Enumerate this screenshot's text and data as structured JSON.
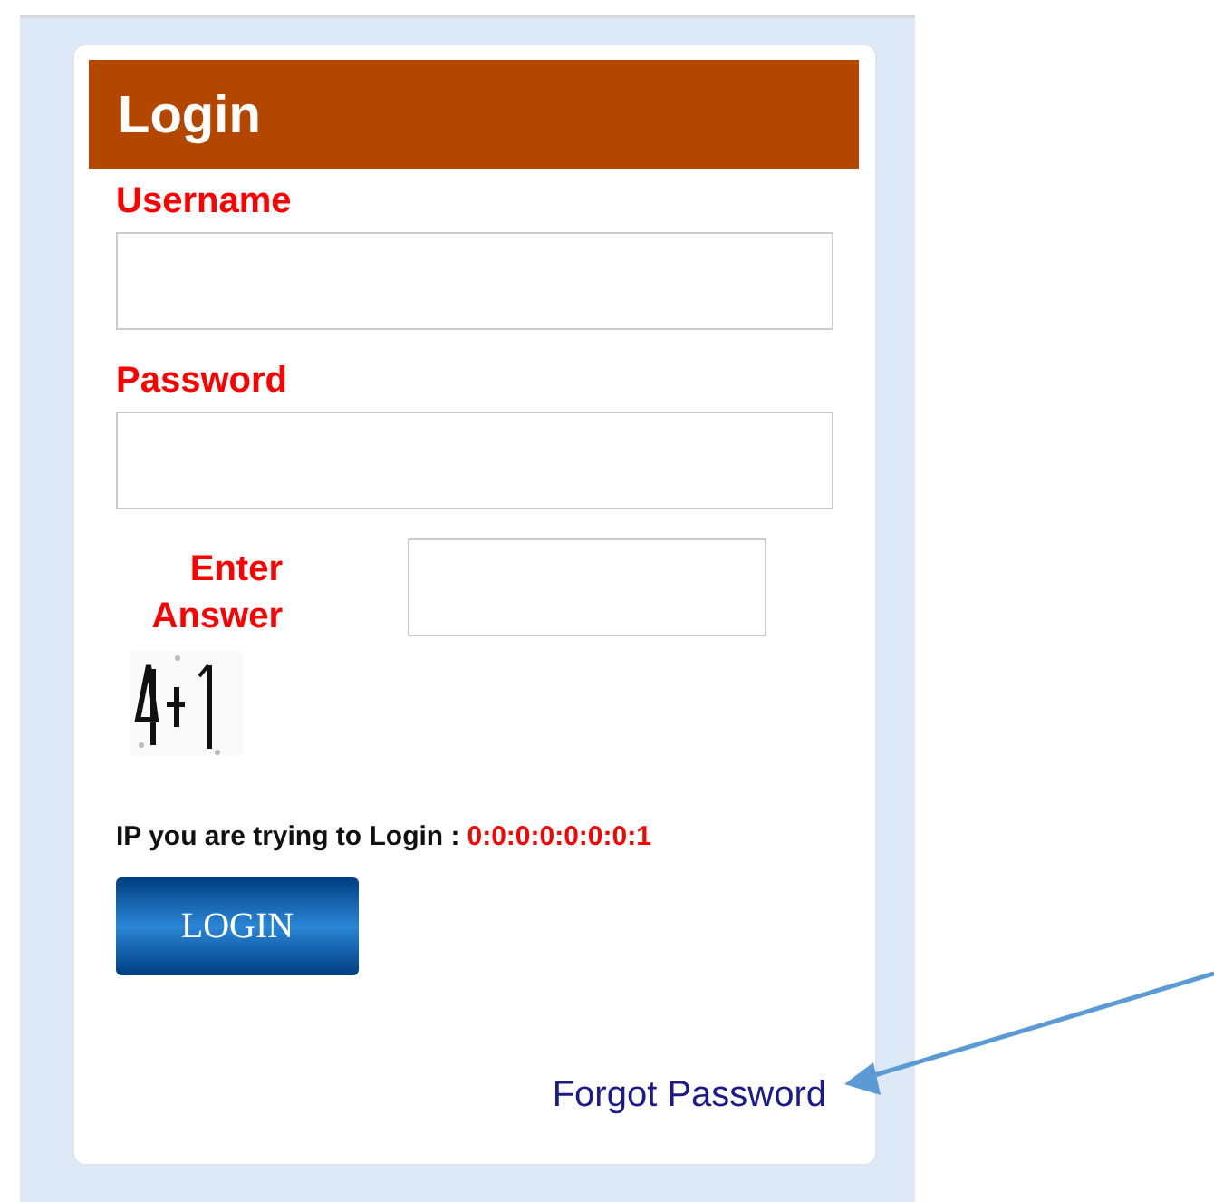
{
  "login_form": {
    "title": "Login",
    "username": {
      "label": "Username"
    },
    "password": {
      "label": "Password"
    },
    "captcha": {
      "label": "Enter Answer"
    },
    "ip_notice": {
      "label": "IP you are trying to Login :",
      "value": "0:0:0:0:0:0:0:1"
    },
    "buttons": [
      "LOGIN"
    ],
    "forgot_link": "Forgot Password"
  }
}
